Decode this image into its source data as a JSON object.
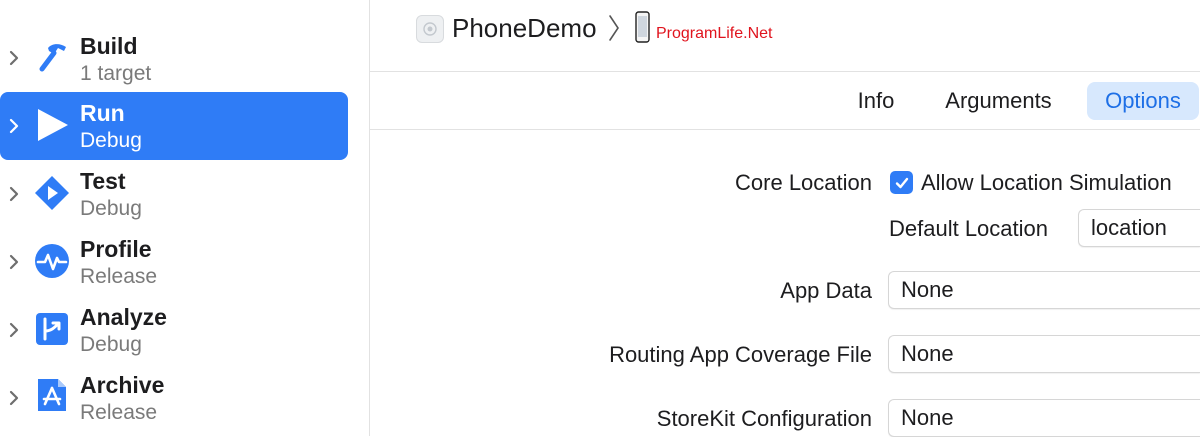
{
  "sidebar": {
    "actions": [
      {
        "title": "Build",
        "subtitle": "1 target",
        "icon": "hammer-icon",
        "selected": false
      },
      {
        "title": "Run",
        "subtitle": "Debug",
        "icon": "play-icon",
        "selected": true
      },
      {
        "title": "Test",
        "subtitle": "Debug",
        "icon": "test-diamond-icon",
        "selected": false
      },
      {
        "title": "Profile",
        "subtitle": "Release",
        "icon": "waveform-icon",
        "selected": false
      },
      {
        "title": "Analyze",
        "subtitle": "Debug",
        "icon": "analyze-icon",
        "selected": false
      },
      {
        "title": "Archive",
        "subtitle": "Release",
        "icon": "app-store-icon",
        "selected": false
      }
    ]
  },
  "header": {
    "scheme_name": "PhoneDemo",
    "watermark": "ProgramLife.Net"
  },
  "tabs": [
    {
      "label": "Info",
      "active": false
    },
    {
      "label": "Arguments",
      "active": false
    },
    {
      "label": "Options",
      "active": true
    }
  ],
  "options": {
    "core_location_label": "Core Location",
    "allow_location_simulation": {
      "label": "Allow Location Simulation",
      "checked": true
    },
    "default_location_label": "Default Location",
    "default_location_value": "location",
    "app_data_label": "App Data",
    "app_data_value": "None",
    "routing_label": "Routing App Coverage File",
    "routing_value": "None",
    "storekit_label": "StoreKit Configuration",
    "storekit_value": "None"
  },
  "colors": {
    "accent": "#2f7cf6",
    "selected_tab_bg": "#d7e8fd",
    "watermark": "#e0141e"
  }
}
